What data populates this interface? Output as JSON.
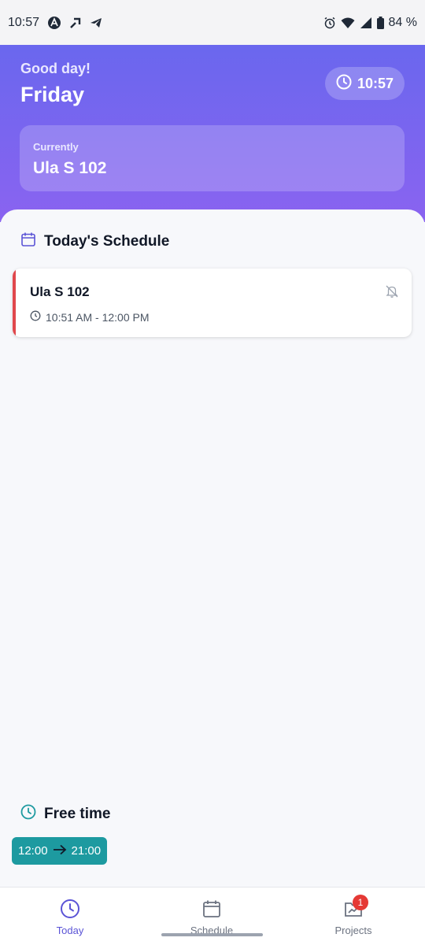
{
  "status_bar": {
    "time": "10:57",
    "battery": "84 %"
  },
  "header": {
    "greeting": "Good day!",
    "day": "Friday",
    "clock": "10:57",
    "current_label": "Currently",
    "current_value": "Ula S 102"
  },
  "schedule": {
    "title": "Today's Schedule",
    "events": [
      {
        "name": "Ula S 102",
        "time": "10:51 AM - 12:00 PM",
        "color": "#e0474c"
      }
    ]
  },
  "free_time": {
    "title": "Free time",
    "start": "12:00",
    "end": "21:00"
  },
  "nav": {
    "items": [
      {
        "label": "Today",
        "icon": "clock-icon",
        "active": true
      },
      {
        "label": "Schedule",
        "icon": "calendar-icon",
        "active": false
      },
      {
        "label": "Projects",
        "icon": "folder-chart-icon",
        "active": false,
        "badge": "1"
      }
    ]
  },
  "colors": {
    "header_gradient_start": "#6a67ee",
    "header_gradient_end": "#8a63f0",
    "accent_red": "#e0474c",
    "free_chip": "#1d9aa0",
    "nav_active": "#5b54d6"
  }
}
